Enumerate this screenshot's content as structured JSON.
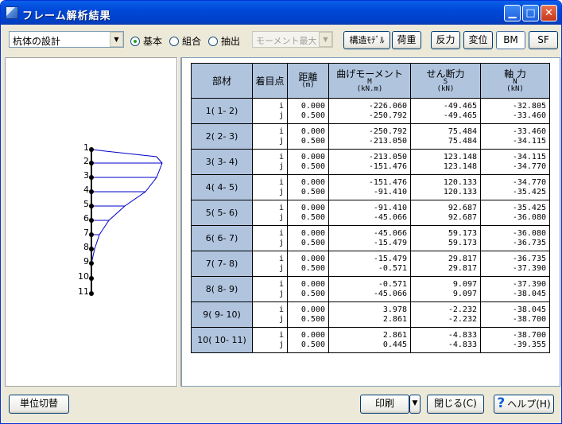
{
  "window": {
    "title": "フレーム解析結果",
    "icon": "app-frame-icon",
    "controls": [
      "minimize",
      "maximize",
      "close"
    ]
  },
  "toolbar": {
    "case_combo": "杭体の設計",
    "radios": [
      {
        "label": "基本",
        "checked": true
      },
      {
        "label": "組合",
        "checked": false
      },
      {
        "label": "抽出",
        "checked": false
      }
    ],
    "extract_combo": "モーメント最大",
    "model_button": "構造ﾓﾃﾞﾙ",
    "load_button": "荷重",
    "reaction_button": "反力",
    "disp_button": "変位",
    "bm_button": "BM",
    "sf_button": "SF",
    "active_view": "BM"
  },
  "diagram": {
    "node_labels": [
      "1",
      "2",
      "3",
      "4",
      "5",
      "6",
      "7",
      "8",
      "9",
      "10",
      "11"
    ]
  },
  "table": {
    "headers": {
      "member": "部材",
      "point": "着目点",
      "dist": "距離",
      "dist_unit": "(m)",
      "moment": "曲げモーメント",
      "moment_sym": "M",
      "moment_unit": "(kN.m)",
      "shear": "せん断力",
      "shear_sym": "S",
      "shear_unit": "(kN)",
      "axial": "軸 力",
      "axial_sym": "N",
      "axial_unit": "(kN)"
    },
    "rows": [
      {
        "member": "1( 1- 2)",
        "pi": "i",
        "pj": "j",
        "di": "0.000",
        "dj": "0.500",
        "mi": "-226.060",
        "mj": "-250.792",
        "si": "-49.465",
        "sj": "-49.465",
        "ni": "-32.805",
        "nj": "-33.460"
      },
      {
        "member": "2( 2- 3)",
        "pi": "i",
        "pj": "j",
        "di": "0.000",
        "dj": "0.500",
        "mi": "-250.792",
        "mj": "-213.050",
        "si": "75.484",
        "sj": "75.484",
        "ni": "-33.460",
        "nj": "-34.115"
      },
      {
        "member": "3( 3- 4)",
        "pi": "i",
        "pj": "j",
        "di": "0.000",
        "dj": "0.500",
        "mi": "-213.050",
        "mj": "-151.476",
        "si": "123.148",
        "sj": "123.148",
        "ni": "-34.115",
        "nj": "-34.770"
      },
      {
        "member": "4( 4- 5)",
        "pi": "i",
        "pj": "j",
        "di": "0.000",
        "dj": "0.500",
        "mi": "-151.476",
        "mj": "-91.410",
        "si": "120.133",
        "sj": "120.133",
        "ni": "-34.770",
        "nj": "-35.425"
      },
      {
        "member": "5( 5- 6)",
        "pi": "i",
        "pj": "j",
        "di": "0.000",
        "dj": "0.500",
        "mi": "-91.410",
        "mj": "-45.066",
        "si": "92.687",
        "sj": "92.687",
        "ni": "-35.425",
        "nj": "-36.080"
      },
      {
        "member": "6( 6- 7)",
        "pi": "i",
        "pj": "j",
        "di": "0.000",
        "dj": "0.500",
        "mi": "-45.066",
        "mj": "-15.479",
        "si": "59.173",
        "sj": "59.173",
        "ni": "-36.080",
        "nj": "-36.735"
      },
      {
        "member": "7( 7- 8)",
        "pi": "i",
        "pj": "j",
        "di": "0.000",
        "dj": "0.500",
        "mi": "-15.479",
        "mj": "-0.571",
        "si": "29.817",
        "sj": "29.817",
        "ni": "-36.735",
        "nj": "-37.390"
      },
      {
        "member": "8( 8- 9)",
        "pi": "i",
        "pj": "j",
        "di": "0.000",
        "dj": "0.500",
        "mi": "-0.571",
        "mj": "-45.066",
        "si": "9.097",
        "sj": "9.097",
        "ni": "-37.390",
        "nj": "-38.045"
      },
      {
        "member": "9( 9- 10)",
        "pi": "i",
        "pj": "j",
        "di": "0.000",
        "dj": "0.500",
        "mi": "3.978",
        "mj": "2.861",
        "si": "-2.232",
        "sj": "-2.232",
        "ni": "-38.045",
        "nj": "-38.700"
      },
      {
        "member": "10( 10- 11)",
        "pi": "i",
        "pj": "j",
        "di": "0.000",
        "dj": "0.500",
        "mi": "2.861",
        "mj": "0.445",
        "si": "-4.833",
        "sj": "-4.833",
        "ni": "-38.700",
        "nj": "-39.355"
      }
    ]
  },
  "footer": {
    "unit_button": "単位切替",
    "print_button": "印刷",
    "close_button": "閉じる(C)",
    "help_button": "ヘルプ(H)"
  }
}
